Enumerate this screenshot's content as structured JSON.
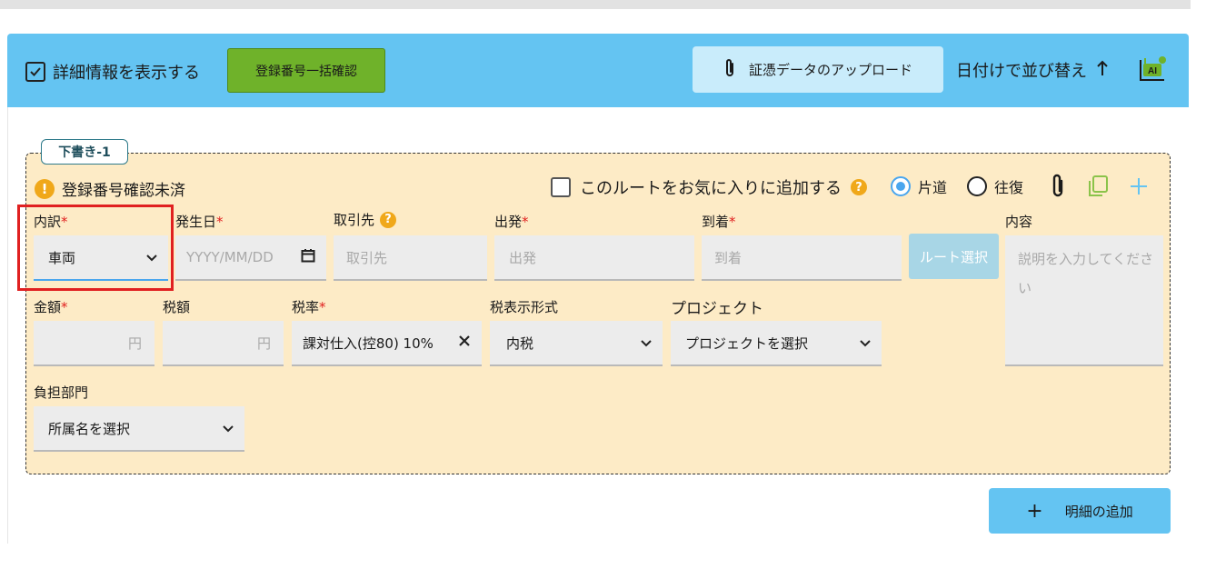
{
  "header": {
    "show_details_label": "詳細情報を表示する",
    "bulk_confirm_label": "登録番号一括確認",
    "upload_label": "証憑データのアップロード",
    "sort_label": "日付けで並び替え",
    "ai_label": "AI"
  },
  "draft": {
    "tag": "下書き-1",
    "warning_text": "登録番号確認未済",
    "favorite_label": "このルートをお気に入りに追加する",
    "help_mark": "?",
    "oneway_label": "片道",
    "roundtrip_label": "往復",
    "warn_mark": "!"
  },
  "fields": {
    "category": {
      "label": "内訳",
      "required": "*",
      "value": "車両"
    },
    "date": {
      "label": "発生日",
      "required": "*",
      "placeholder": "YYYY/MM/DD"
    },
    "partner": {
      "label": "取引先",
      "placeholder": "取引先"
    },
    "departure": {
      "label": "出発",
      "required": "*",
      "placeholder": "出発"
    },
    "arrival": {
      "label": "到着",
      "required": "*",
      "placeholder": "到着"
    },
    "route_button": "ルート選択",
    "content": {
      "label": "内容",
      "placeholder": "説明を入力してください"
    },
    "amount": {
      "label": "金額",
      "required": "*",
      "unit": "円"
    },
    "tax_amount": {
      "label": "税額",
      "unit": "円"
    },
    "tax_rate": {
      "label": "税率",
      "required": "*",
      "value": "課対仕入(控80) 10%"
    },
    "tax_display": {
      "label": "税表示形式",
      "value": "内税"
    },
    "project": {
      "label": "プロジェクト",
      "value": "プロジェクトを選択"
    },
    "department": {
      "label": "負担部門",
      "value": "所属名を選択"
    }
  },
  "footer": {
    "add_plus": "+",
    "add_label": "明細の追加"
  },
  "colors": {
    "header_bg": "#64c4f2",
    "draft_bg": "#fdebc6",
    "green_button": "#6fb22a",
    "required": "#e02020",
    "highlight": "#e02020"
  }
}
